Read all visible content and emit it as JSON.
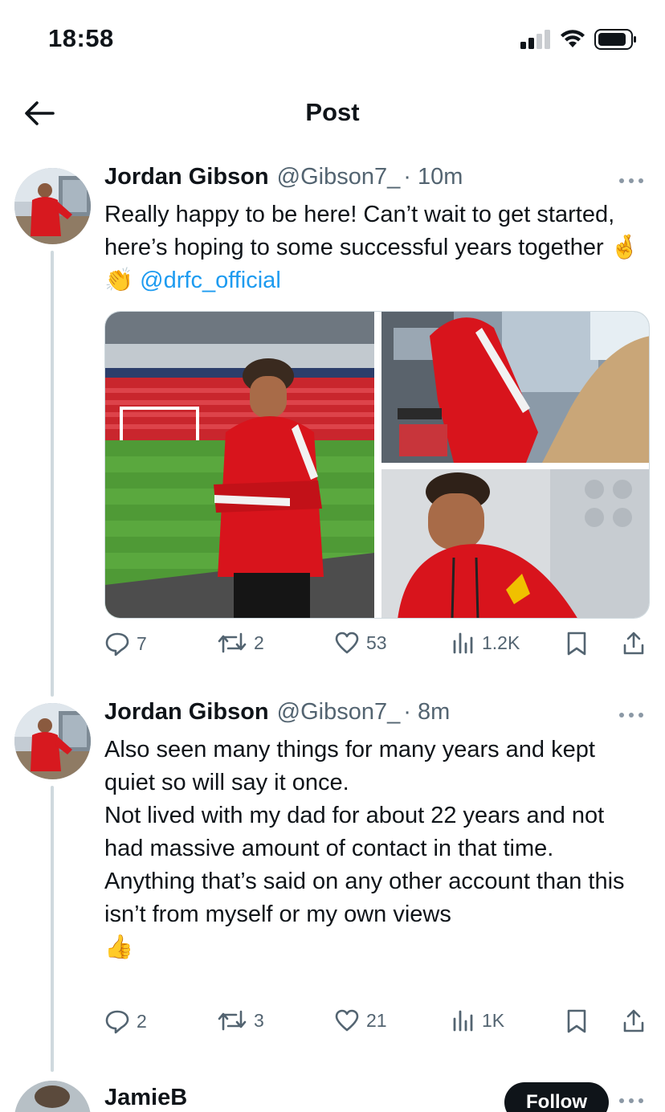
{
  "status_bar": {
    "time": "18:58"
  },
  "header": {
    "title": "Post"
  },
  "tweets": [
    {
      "name": "Jordan Gibson",
      "handle": "@Gibson7_",
      "time": "· 10m",
      "text_before": "Really happy to be here! Can’t wait to get started, here’s hoping to some successful years together 🤞 👏 ",
      "mention": "@drfc_official",
      "actions": {
        "replies": "7",
        "reposts": "2",
        "likes": "53",
        "views": "1.2K"
      }
    },
    {
      "name": "Jordan Gibson",
      "handle": "@Gibson7_",
      "time": "· 8m",
      "text": "Also seen many things for many years and kept quiet so will say it once.\nNot lived with my dad for about 22 years and not had massive amount of contact in that time.\nAnything that’s said on any other account than this isn’t from myself or my own views\n👍",
      "actions": {
        "replies": "2",
        "reposts": "3",
        "likes": "21",
        "views": "1K"
      }
    },
    {
      "name": "JamieB",
      "follow_label": "Follow"
    }
  ],
  "colors": {
    "accent": "#1d9bf0",
    "secondary_text": "#536471",
    "primary_text": "#0f1419",
    "thread_line": "#cfd9de"
  }
}
